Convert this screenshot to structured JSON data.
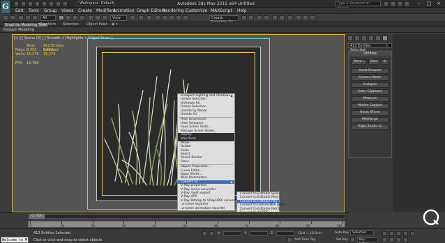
{
  "titlebar": {
    "logo_letter": "G",
    "workspace": "Workspace: Default",
    "window_title": "Autodesk 3ds Max 2015 x64      Untitled",
    "search_placeholder": "Type a keyword or phrase",
    "minimize": "–",
    "maximize": "□",
    "close": "×"
  },
  "menubar": [
    "Edit",
    "Tools",
    "Group",
    "Views",
    "Create",
    "Modifiers",
    "Animation",
    "Graph Editors",
    "Rendering",
    "Customize",
    "MAXScript",
    "Help"
  ],
  "toolbar": {
    "filter": "All",
    "view_select": "View",
    "selection_set": "Create Selection Se"
  },
  "ribbon": {
    "tabs": [
      "Graphite Modeling Tools",
      "Freeform",
      "Selection",
      "Object Paint"
    ],
    "active_tab": 0,
    "subpanel": "Polygon Modeling"
  },
  "viewport": {
    "label": "[+ ] [ Scene (0) ] [ Smooth + Highlights + Edged Faces ]",
    "stats": {
      "header_col1": "Total",
      "header_col2": "412 Entities Selected",
      "polys_label": "Polys:",
      "polys_total": "8,453",
      "polys_sel": "8,453",
      "verts_label": "Verts:",
      "verts_total": "16,276",
      "verts_sel": "16,276",
      "fps_label": "FPS:",
      "fps_value": "13.780"
    }
  },
  "quad_menu": {
    "left": [
      {
        "label": "Viewport Lighting and Shadows",
        "arrow": true,
        "type": "item"
      },
      {
        "label": "Isolate Selection",
        "type": "item"
      },
      {
        "label": "Unfreeze All",
        "type": "item"
      },
      {
        "label": "Freeze Selection",
        "type": "item"
      },
      {
        "label": "Unhide by Name",
        "type": "item"
      },
      {
        "label": "Unhide All",
        "type": "item"
      },
      {
        "type": "sep"
      },
      {
        "label": "Hide Unselected",
        "type": "item"
      },
      {
        "label": "Hide Selection",
        "type": "item"
      },
      {
        "label": "Save Scene State...",
        "type": "item"
      },
      {
        "label": "Manage Scene States...",
        "type": "item"
      },
      {
        "label": "display",
        "type": "head"
      },
      {
        "label": "transform",
        "type": "head"
      },
      {
        "label": "Move",
        "type": "item"
      },
      {
        "label": "Rotate",
        "type": "item"
      },
      {
        "label": "Scale",
        "type": "item"
      },
      {
        "label": "Select",
        "type": "item"
      },
      {
        "label": "Select Similar",
        "type": "item"
      },
      {
        "label": "Place",
        "type": "item"
      },
      {
        "type": "sep"
      },
      {
        "label": "Object Properties...",
        "type": "item"
      },
      {
        "label": "Curve Editor...",
        "type": "item"
      },
      {
        "label": "Dope Sheet...",
        "type": "item"
      },
      {
        "label": "Wire Parameters...",
        "type": "item"
      },
      {
        "label": "Convert To:",
        "arrow": true,
        "type": "sel"
      },
      {
        "label": "V-Ray properties",
        "type": "item"
      },
      {
        "label": "V-Ray scene converter",
        "type": "item"
      },
      {
        "label": "V-Ray mesh export",
        "type": "item"
      },
      {
        "label": "V-Ray VFB",
        "type": "item"
      },
      {
        "label": "V-Ray Bitmap to VRayHDRI converter",
        "type": "item"
      },
      {
        "label": ".vrscene exporter",
        "type": "item"
      },
      {
        "label": ".vrscene animation exporter",
        "type": "item"
      }
    ],
    "convert_submenu": [
      {
        "label": "Convert to Editable Spline",
        "type": "item"
      },
      {
        "label": "Convert to Editable Mesh",
        "type": "item"
      },
      {
        "label": "Convert to Editable Poly",
        "type": "sel"
      },
      {
        "label": "Convert to Deformable gPoly",
        "type": "item"
      },
      {
        "label": "Convert to Editable Patch",
        "type": "item"
      },
      {
        "label": "Convert to NURBS",
        "type": "item"
      }
    ]
  },
  "command_panel": {
    "name_field": "412 Entities Selected",
    "rollout_title": "Utilities",
    "more_label": "More...",
    "sets_label": "Sets",
    "buttons": [
      "Asset Browser",
      "Camera Match",
      "Collapse",
      "Color Clipboard",
      "Measure",
      "Motion Capture",
      "Reset XForm",
      "MAXScript",
      "Flight Studio (c)"
    ]
  },
  "timeline": {
    "frame_display": "0 / 100",
    "ticks": [
      "0",
      "10",
      "20",
      "30",
      "40",
      "50",
      "60",
      "70",
      "80",
      "90",
      "100"
    ]
  },
  "status": {
    "maxscript_text": "Welcome to M",
    "selection": "412 Entities Selected",
    "prompt": "Click or click-and-drag to select objects",
    "x_label": "X:",
    "y_label": "Y:",
    "z_label": "Z:",
    "grid": "Grid = 10.0cm",
    "add_time_tag": "Add Time Tag",
    "auto_key": "Auto Key",
    "selected": "Selected",
    "set_key": "Set Key",
    "key_filters": "Key Filters..."
  },
  "colors": {
    "stats_text": "#e6c94a",
    "viewport_border": "#d4b13a",
    "safe_frame": "#6fd6e0",
    "menu_highlight": "#3a6fb8"
  }
}
